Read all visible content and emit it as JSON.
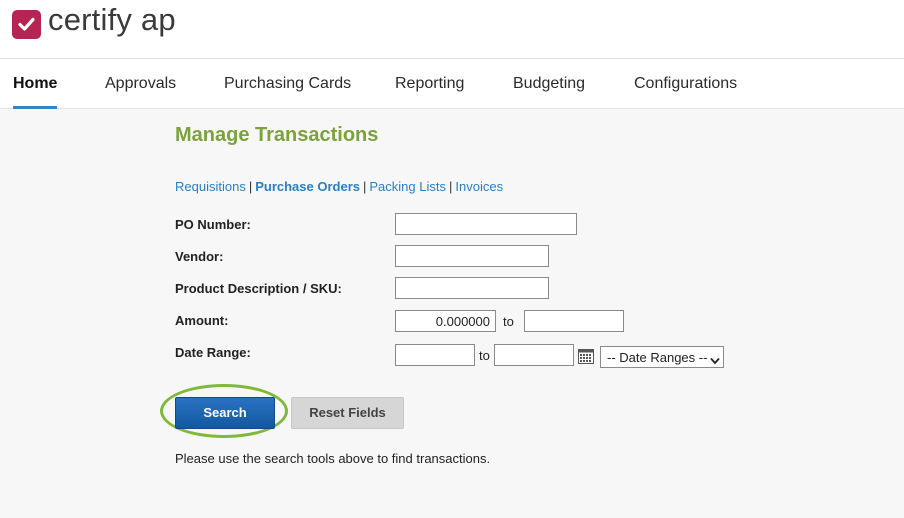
{
  "brand": {
    "name": "certify ap",
    "mark_color": "#b52453"
  },
  "nav": {
    "items": [
      {
        "label": "Home",
        "active": true
      },
      {
        "label": "Approvals"
      },
      {
        "label": "Purchasing Cards"
      },
      {
        "label": "Reporting"
      },
      {
        "label": "Budgeting"
      },
      {
        "label": "Configurations"
      }
    ]
  },
  "page": {
    "title": "Manage Transactions",
    "title_color": "#7ba23c",
    "tabs": [
      {
        "label": "Requisitions"
      },
      {
        "label": "Purchase Orders",
        "current": true
      },
      {
        "label": "Packing Lists"
      },
      {
        "label": "Invoices"
      }
    ],
    "tab_separator": "|"
  },
  "form": {
    "po_number": {
      "label": "PO Number:",
      "value": ""
    },
    "vendor": {
      "label": "Vendor:",
      "value": ""
    },
    "product": {
      "label": "Product Description / SKU:",
      "value": ""
    },
    "amount": {
      "label": "Amount:",
      "from": "0.000000",
      "to_label": "to",
      "to": ""
    },
    "date_range": {
      "label": "Date Range:",
      "from": "",
      "to_label": "to",
      "to": "",
      "preset": "-- Date Ranges --"
    }
  },
  "actions": {
    "search": "Search",
    "reset": "Reset Fields",
    "highlight_color": "#7fba3a"
  },
  "hint": "Please use the search tools above to find transactions.",
  "icons": {
    "logo": "checkmark-icon",
    "calendar": "calendar-icon",
    "dropdown": "chevron-down-icon"
  }
}
